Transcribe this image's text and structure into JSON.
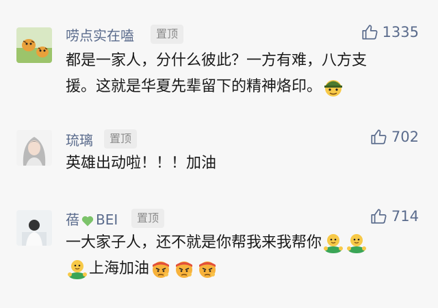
{
  "comments": [
    {
      "name": "唠点实在嗑",
      "pin_label": "置顶",
      "likes": "1335",
      "lines": [
        "都是一家人，分什么彼此？一方有难，八方支",
        "援。这就是华夏先辈留下的精神烙印。"
      ],
      "trailing_emoji": [
        "soldier-emoji"
      ]
    },
    {
      "name": "琉璃",
      "pin_label": "置顶",
      "likes": "702",
      "lines": [
        "英雄出动啦！！！加油"
      ]
    },
    {
      "name_prefix": "蓓",
      "name_suffix": "BEI",
      "name_heart_icon": "green-heart-icon",
      "pin_label": "置顶",
      "likes": "714",
      "lines": [
        "一大家子人，还不就是你帮我来我帮你",
        "上海加油"
      ],
      "line1_emoji": [
        "hug-emoji",
        "hug-emoji"
      ],
      "line2_leading_emoji": [
        "hug-emoji"
      ],
      "line2_trailing_emoji": [
        "determined-emoji",
        "determined-emoji",
        "determined-emoji"
      ]
    }
  ],
  "colors": {
    "name": "#5a6b8c",
    "background": "#f7f7f7",
    "pin_bg": "#ececec",
    "text": "#1a1a1a"
  }
}
